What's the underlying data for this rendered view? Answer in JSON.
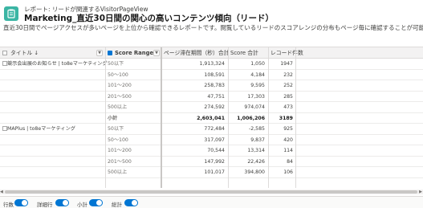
{
  "header": {
    "eyebrow": "レポート: リードが関連するVisitorPageView",
    "title": "Marketing_直近30日間の関心の高いコンテンツ傾向（リード）",
    "description": "直近30日間でページアクセスが多いページを上位から確認できるレポートです。閲覧しているリードのスコアレンジの分布もページ毎に確認することが可能です。"
  },
  "table": {
    "headers": {
      "title": "タイトル ↓",
      "score_range": "Score Range ↑",
      "dwell_time": "ページ滞在期間（秒）合計",
      "score_total": "Score 合計",
      "record_count": "レコード件数"
    },
    "groups": [
      {
        "label": "競示会出展のお知らせ | to8eマーケティング",
        "rows": [
          {
            "range": "50以下",
            "dwell": "1,913,324",
            "score": "1,050",
            "count": "1947"
          },
          {
            "range": "50～100",
            "dwell": "108,591",
            "score": "4,184",
            "count": "232"
          },
          {
            "range": "101～200",
            "dwell": "258,783",
            "score": "9,595",
            "count": "252"
          },
          {
            "range": "201～500",
            "dwell": "47,751",
            "score": "17,303",
            "count": "285"
          },
          {
            "range": "500以上",
            "dwell": "274,592",
            "score": "974,074",
            "count": "473"
          }
        ],
        "subtotal": {
          "label": "小計",
          "dwell": "2,603,041",
          "score": "1,006,206",
          "count": "3189"
        }
      },
      {
        "label": "MAPlus | to8eマーケティング",
        "rows": [
          {
            "range": "50以下",
            "dwell": "772,484",
            "score": "-2,585",
            "count": "925"
          },
          {
            "range": "50～100",
            "dwell": "317,097",
            "score": "9,837",
            "count": "420"
          },
          {
            "range": "101～200",
            "dwell": "70,544",
            "score": "13,314",
            "count": "114"
          },
          {
            "range": "201～500",
            "dwell": "147,992",
            "score": "22,426",
            "count": "84"
          },
          {
            "range": "500以上",
            "dwell": "101,017",
            "score": "394,800",
            "count": "106"
          }
        ]
      }
    ]
  },
  "footer": {
    "toggles": [
      {
        "label": "行数",
        "on": true
      },
      {
        "label": "詳細行",
        "on": true
      },
      {
        "label": "小計",
        "on": true
      },
      {
        "label": "総計",
        "on": true
      }
    ]
  },
  "colors": {
    "accent": "#0176d3",
    "app_icon": "#3bb5a4"
  }
}
